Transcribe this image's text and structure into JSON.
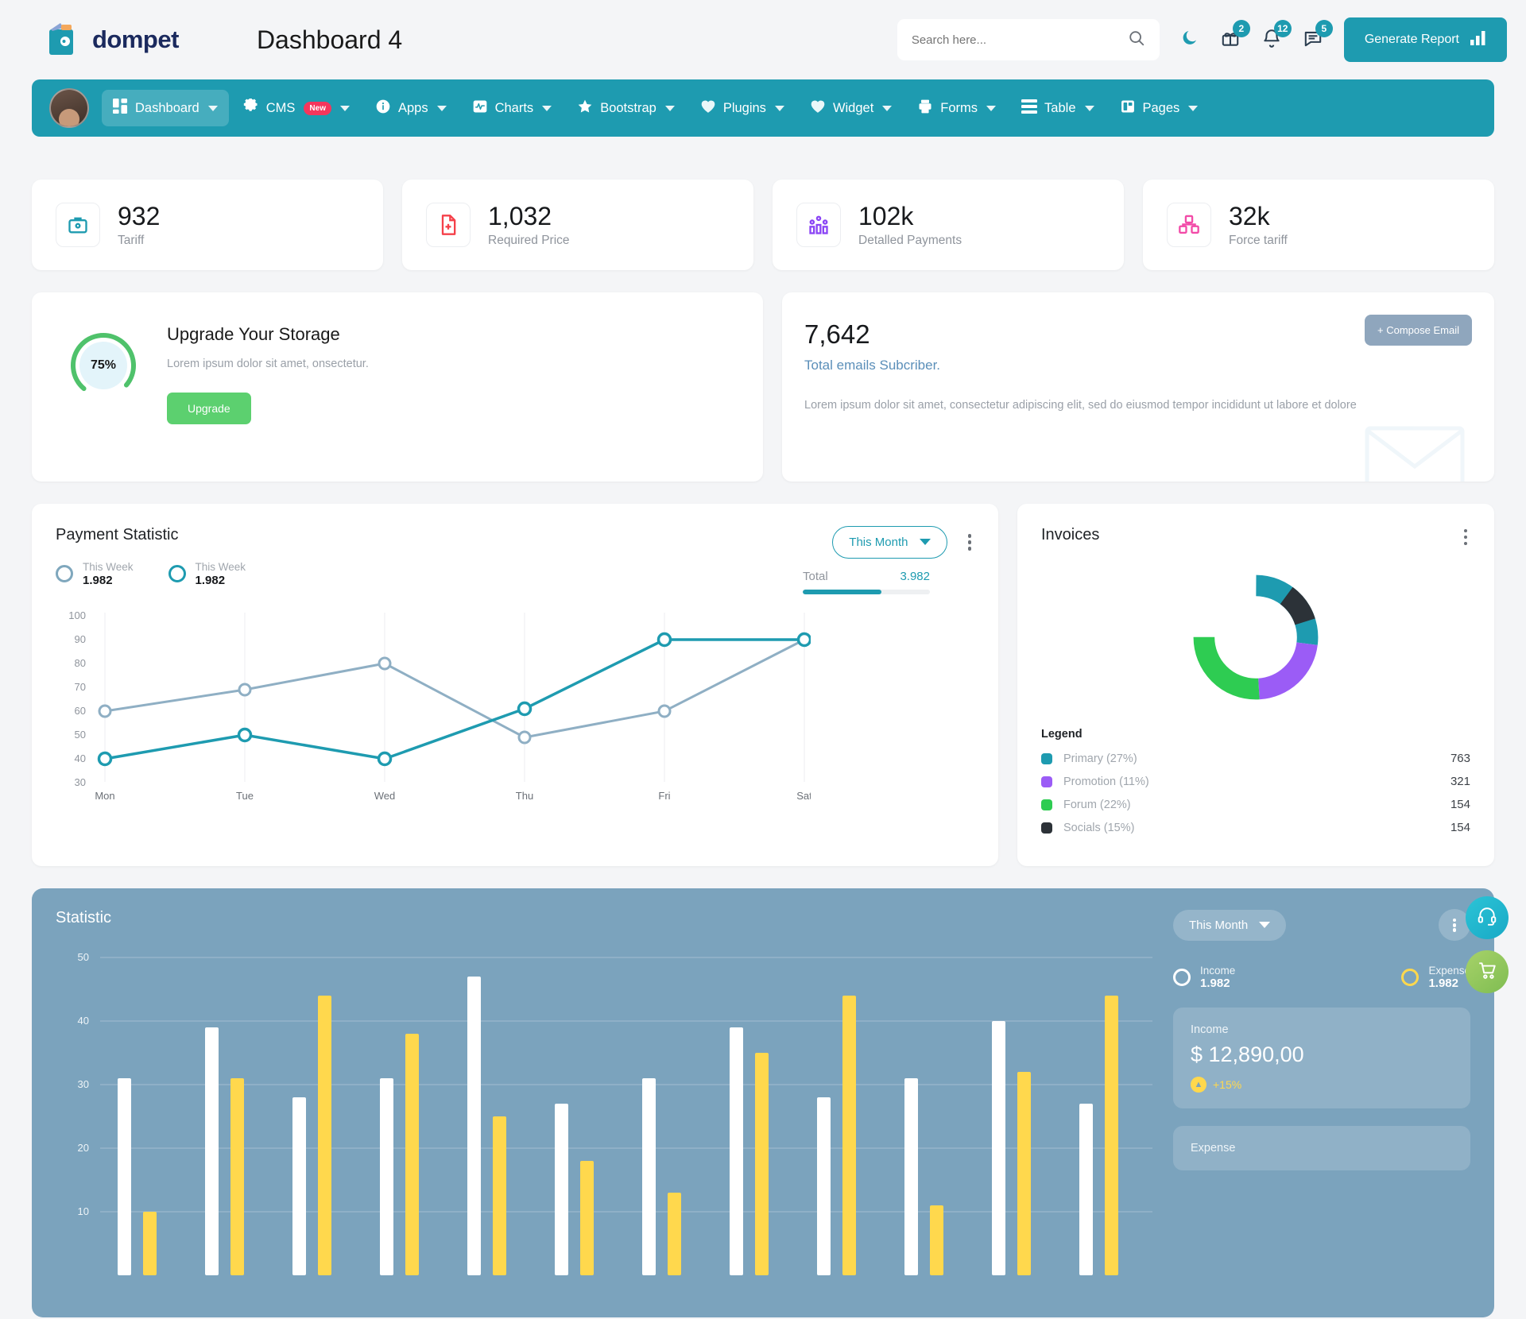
{
  "header": {
    "brand": "dompet",
    "page_title": "Dashboard 4",
    "search_placeholder": "Search here...",
    "search_value": "",
    "icons": {
      "moon": "moon-icon",
      "gift": "gift-icon",
      "bell": "bell-icon",
      "message": "message-icon"
    },
    "badges": {
      "gift": "2",
      "bell": "12",
      "message": "5"
    },
    "generate_report": "Generate Report"
  },
  "nav": {
    "items": [
      {
        "label": "Dashboard",
        "icon": "grid-icon",
        "active": true,
        "caret": true,
        "badge": ""
      },
      {
        "label": "CMS",
        "icon": "gear-icon",
        "active": false,
        "caret": true,
        "badge": "New"
      },
      {
        "label": "Apps",
        "icon": "info-icon",
        "active": false,
        "caret": true,
        "badge": ""
      },
      {
        "label": "Charts",
        "icon": "pulse-icon",
        "active": false,
        "caret": true,
        "badge": ""
      },
      {
        "label": "Bootstrap",
        "icon": "star-icon",
        "active": false,
        "caret": true,
        "badge": ""
      },
      {
        "label": "Plugins",
        "icon": "heart-icon",
        "active": false,
        "caret": true,
        "badge": ""
      },
      {
        "label": "Widget",
        "icon": "heart-icon",
        "active": false,
        "caret": true,
        "badge": ""
      },
      {
        "label": "Forms",
        "icon": "printer-icon",
        "active": false,
        "caret": true,
        "badge": ""
      },
      {
        "label": "Table",
        "icon": "list-icon",
        "active": false,
        "caret": true,
        "badge": ""
      },
      {
        "label": "Pages",
        "icon": "book-icon",
        "active": false,
        "caret": true,
        "badge": ""
      }
    ]
  },
  "stats": [
    {
      "value": "932",
      "label": "Tariff",
      "icon": "briefcase-icon",
      "color": "#1e9bb0"
    },
    {
      "value": "1,032",
      "label": "Required Price",
      "icon": "file-plus-icon",
      "color": "#f5404a"
    },
    {
      "value": "102k",
      "label": "Detalled Payments",
      "icon": "analytics-icon",
      "color": "#8b45f5"
    },
    {
      "value": "32k",
      "label": "Force tariff",
      "icon": "boxes-icon",
      "color": "#f24ba8"
    }
  ],
  "storage": {
    "percent": "75%",
    "percent_value": 75,
    "title": "Upgrade Your Storage",
    "subtitle": "Lorem ipsum dolor sit amet, onsectetur.",
    "button": "Upgrade",
    "ring_color": "#4fc26b"
  },
  "email": {
    "count": "7,642",
    "subtitle": "Total emails Subcriber.",
    "description": "Lorem ipsum dolor sit amet, consectetur adipiscing elit, sed do eiusmod tempor incididunt ut labore et dolore",
    "compose_button": "+ Compose Email"
  },
  "payment": {
    "title": "Payment Statistic",
    "series_legend": [
      {
        "name": "This Week",
        "value": "1.982",
        "color": "#7fa7bd"
      },
      {
        "name": "This Week",
        "value": "1.982",
        "color": "#1e9bb0"
      }
    ],
    "range": "This Month",
    "total_label": "Total",
    "total_value": "3.982",
    "total_percent": 62
  },
  "invoices": {
    "title": "Invoices",
    "legend_title": "Legend",
    "legend": [
      {
        "name": "Primary (27%)",
        "value": "763",
        "color": "#1e9bb0"
      },
      {
        "name": "Promotion (11%)",
        "value": "321",
        "color": "#9b5cf6"
      },
      {
        "name": "Forum (22%)",
        "value": "154",
        "color": "#2ecc52"
      },
      {
        "name": "Socials (15%)",
        "value": "154",
        "color": "#2c3238"
      }
    ]
  },
  "statistic": {
    "title": "Statistic",
    "range": "This Month",
    "legend": [
      {
        "name": "Income",
        "value": "1.982",
        "color": "#ffffff"
      },
      {
        "name": "Expense",
        "value": "1.982",
        "color": "#ffd84d"
      }
    ],
    "income_card": {
      "label": "Income",
      "amount": "$ 12,890,00",
      "delta": "+15%"
    },
    "expense_card": {
      "label": "Expense",
      "amount": "",
      "delta": ""
    }
  },
  "fabs": [
    {
      "name": "support-icon",
      "glyph": "headset"
    },
    {
      "name": "cart-icon",
      "glyph": "cart"
    }
  ],
  "chart_data": [
    {
      "type": "line",
      "title": "Payment Statistic",
      "categories": [
        "Mon",
        "Tue",
        "Wed",
        "Thu",
        "Fri",
        "Sat"
      ],
      "series": [
        {
          "name": "This Week",
          "color": "#7fa7bd",
          "values": [
            60,
            69,
            80,
            49,
            60,
            90
          ]
        },
        {
          "name": "This Week",
          "color": "#1e9bb0",
          "values": [
            40,
            50,
            40,
            61,
            90,
            90
          ]
        }
      ],
      "ylim": [
        30,
        100
      ],
      "yticks": [
        30,
        40,
        50,
        60,
        70,
        80,
        90,
        100
      ],
      "xlabel": "",
      "ylabel": "",
      "grid": true,
      "legend": "top-left"
    },
    {
      "type": "pie",
      "title": "Invoices",
      "labels": [
        "Primary (27%)",
        "Promotion (11%)",
        "Forum (22%)",
        "Socials (15%)"
      ],
      "values": [
        27,
        11,
        22,
        15
      ],
      "counts": [
        763,
        321,
        154,
        154
      ],
      "colors": [
        "#1e9bb0",
        "#9b5cf6",
        "#2ecc52",
        "#2c3238"
      ],
      "donut": true,
      "legend": "bottom-left"
    },
    {
      "type": "bar",
      "title": "Statistic",
      "series": [
        {
          "name": "Income",
          "color": "#ffffff",
          "values": [
            31,
            39,
            28,
            31,
            47,
            27,
            31,
            39,
            28,
            31,
            40,
            27
          ]
        },
        {
          "name": "Expense",
          "color": "#ffd84d",
          "values": [
            10,
            31,
            44,
            38,
            25,
            18,
            13,
            35,
            44,
            11,
            32,
            44
          ]
        }
      ],
      "ylim": [
        0,
        50
      ],
      "yticks": [
        10,
        20,
        30,
        40,
        50
      ],
      "grid": true,
      "legend": "right"
    }
  ]
}
